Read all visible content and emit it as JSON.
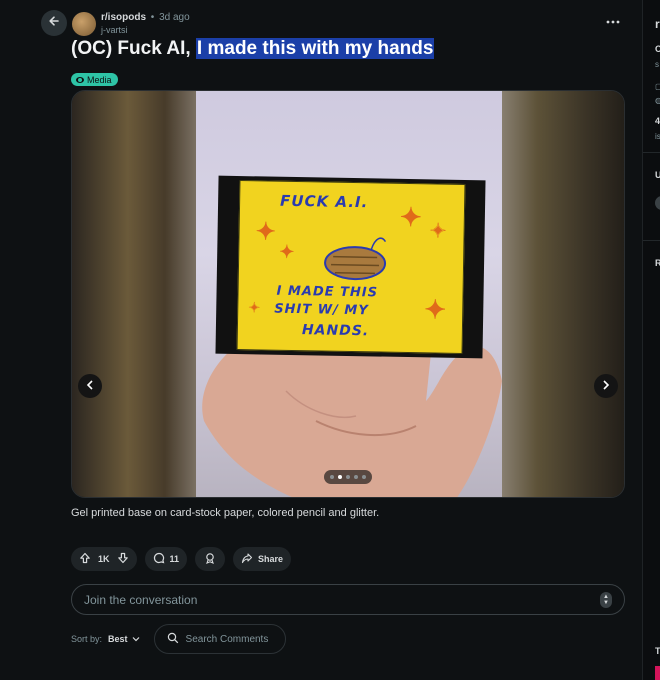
{
  "post": {
    "subreddit": "r/isopods",
    "separator": "•",
    "time_ago": "3d ago",
    "author": "j-vartsi",
    "title_plain": "(OC) Fuck AI, ",
    "title_highlighted": "I made this with my hands",
    "flair": "Media",
    "caption": "Gel printed base on card-stock paper, colored pencil and glitter."
  },
  "card_art": {
    "line1": "FUCK A.I.",
    "line2": "I MADE THIS",
    "line3": "SHIT W/ MY",
    "line4": "HANDS."
  },
  "gallery": {
    "total_images": 5,
    "current_index": 2
  },
  "actions": {
    "vote_count": "1K",
    "comment_count": "11",
    "share_label": "Share"
  },
  "comments": {
    "join_placeholder": "Join the conversation",
    "sort_label": "Sort by:",
    "sort_value": "Best",
    "search_placeholder": "Search Comments"
  },
  "right_pane": {
    "heading_initial": "r",
    "items": [
      "C",
      "s",
      "4",
      "is",
      "U",
      "R",
      "T"
    ]
  },
  "colors": {
    "background": "#0e1113",
    "title_highlight": "#1b3fa8",
    "flair": "#2ec4a6",
    "pill": "#1f2427"
  },
  "icons": {
    "back": "arrow-left-icon",
    "more": "ellipsis-horizontal-icon",
    "upvote": "arrow-up-icon",
    "downvote": "arrow-down-icon",
    "comment": "speech-bubble-icon",
    "award": "award-icon",
    "share": "share-arrow-icon",
    "search": "magnifier-icon"
  }
}
